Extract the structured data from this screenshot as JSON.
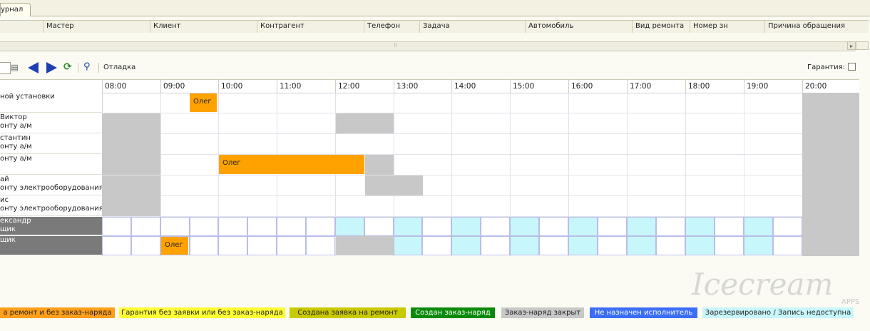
{
  "tab": {
    "label": "урнал"
  },
  "journal": {
    "columns": [
      "Мастер",
      "Клиент",
      "Контрагент",
      "Телефон",
      "Задача",
      "Автомобиль",
      "Вид ремонта",
      "Номер зн",
      "Причина обращения"
    ]
  },
  "toolbar": {
    "debug_label": "Отладка",
    "warranty_label": "Гарантия:",
    "icons": [
      "calendar-icon",
      "prev-arrow-icon",
      "next-arrow-icon",
      "refresh-icon",
      "search-icon"
    ]
  },
  "schedule": {
    "times": [
      "08:00",
      "09:00",
      "10:00",
      "11:00",
      "12:00",
      "13:00",
      "14:00",
      "15:00",
      "16:00",
      "17:00",
      "18:00",
      "19:00",
      "20:00"
    ],
    "rows": [
      {
        "line1": "",
        "line2": "ной установки"
      },
      {
        "line1": "Виктор",
        "line2": "онту а/м"
      },
      {
        "line1": "стантин",
        "line2": "онту а/м"
      },
      {
        "line1": "",
        "line2": "онту а/м"
      },
      {
        "line1": "ай",
        "line2": "онту электрооборудования"
      },
      {
        "line1": "ис",
        "line2": "онту электрооборудования"
      },
      {
        "line1": "ександр",
        "line2": "щик"
      },
      {
        "line1": "",
        "line2": "щик"
      }
    ],
    "bookings": [
      {
        "row": 0,
        "start": "09:30",
        "end": "10:00",
        "label": "Олег"
      },
      {
        "row": 3,
        "start": "10:00",
        "end": "12:30",
        "label": "Олег"
      },
      {
        "row": 7,
        "start": "09:00",
        "end": "09:30",
        "label": "Олег"
      }
    ]
  },
  "legend": [
    {
      "label": "а ремонт и без заказ-наряда",
      "color": "#ff9f1a"
    },
    {
      "label": "Гарантия без заявки или без заказ-наряда",
      "color": "#ffff33"
    },
    {
      "label": "Создана заявка на ремонт",
      "color": "#c9c900"
    },
    {
      "label": "Создан заказ-наряд",
      "color": "#0a8a0a"
    },
    {
      "label": "Заказ-наряд закрыт",
      "color": "#c8c8c8"
    },
    {
      "label": "Не назначен исполнитель",
      "color": "#3b6ef5"
    },
    {
      "label": "Зарезервировано / Запись недоступна",
      "color": "#c7f6fb"
    }
  ],
  "watermark": {
    "text": "Icecream",
    "sub": "APPS"
  }
}
